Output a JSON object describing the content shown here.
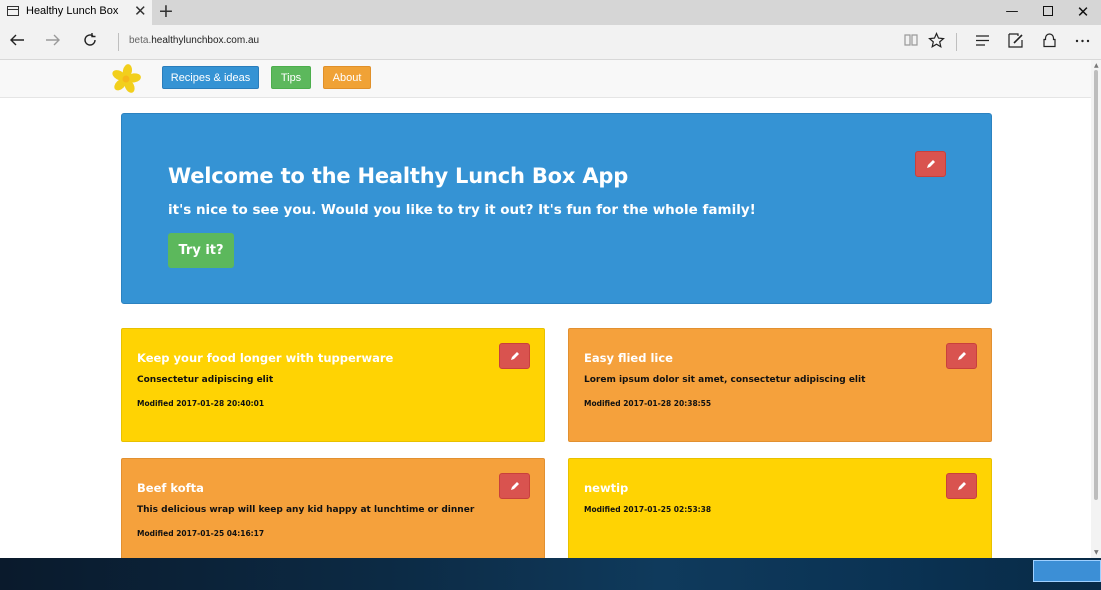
{
  "browser": {
    "tab_title": "Healthy Lunch Box",
    "tab_close": "✕",
    "new_tab": "+",
    "url_prefix": "beta.",
    "url_domain": "healthylunchbox.com.au",
    "icons": {
      "back": "arrow-left-icon",
      "forward": "arrow-right-icon",
      "refresh": "refresh-icon",
      "reading_view": "book-icon",
      "favorite": "star-icon",
      "hub": "hub-icon",
      "web_note": "pen-icon",
      "share": "share-icon",
      "more": "ellipsis-icon"
    }
  },
  "navbar": {
    "items": [
      {
        "label": "Recipes & ideas",
        "color": "#3593d4"
      },
      {
        "label": "Tips",
        "color": "#5cb85c"
      },
      {
        "label": "About",
        "color": "#f0a236"
      }
    ]
  },
  "hero": {
    "title": "Welcome to the Healthy Lunch Box App",
    "subtitle": "it's nice to see you. Would you like to try it out? It's fun for the whole family!",
    "button_label": "Try it?",
    "color": "#3593d4"
  },
  "cards": [
    {
      "title": "Keep your food longer with tupperware",
      "description": "Consectetur adipiscing elit",
      "modified_label": "Modified",
      "modified": "2017-01-28 20:40:01",
      "color": "#ffd303"
    },
    {
      "title": "Easy flied lice",
      "description": "Lorem ipsum dolor sit amet, consectetur adipiscing elit",
      "modified_label": "Modified",
      "modified": "2017-01-28 20:38:55",
      "color": "#f5a13c"
    },
    {
      "title": "Beef kofta",
      "description": "This delicious wrap will keep any kid happy at lunchtime or dinner",
      "modified_label": "Modified",
      "modified": "2017-01-25 04:16:17",
      "color": "#f5a13c"
    },
    {
      "title": "newtip",
      "description": "",
      "modified_label": "Modified",
      "modified": "2017-01-25 02:53:38",
      "color": "#ffd303"
    }
  ],
  "colors": {
    "edit_button": "#d9534f",
    "accent": "#3593d4"
  }
}
